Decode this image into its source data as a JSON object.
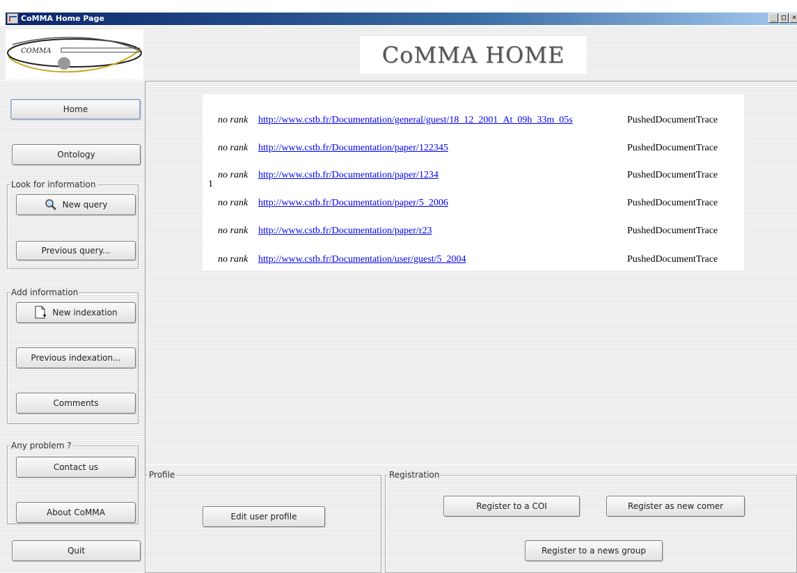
{
  "window": {
    "title": "CoMMA Home Page",
    "controls": [
      "_",
      "□",
      "×"
    ]
  },
  "header": {
    "logo_text": "COMMA",
    "title": "CoMMA HOME"
  },
  "sidebar": {
    "home_label": "Home",
    "ontology_label": "Ontology",
    "look_group": {
      "legend": "Look for information",
      "new_query_label": "New query",
      "previous_query_label": "Previous query..."
    },
    "add_group": {
      "legend": "Add information",
      "new_indexation_label": "New indexation",
      "previous_indexation_label": "Previous indexation...",
      "comments_label": "Comments"
    },
    "problem_group": {
      "legend": "Any problem ?",
      "contact_label": "Contact us",
      "about_label": "About CoMMA"
    },
    "quit_label": "Quit"
  },
  "results": {
    "index": "1",
    "rows": [
      {
        "rank": "no rank",
        "url": "http://www.cstb.fr/Documentation/general/guest/18_12_2001_At_09h_33m_05s",
        "trace": "PushedDocumentTrace"
      },
      {
        "rank": "no rank",
        "url": "http://www.cstb.fr/Documentation/paper/122345",
        "trace": "PushedDocumentTrace"
      },
      {
        "rank": "no rank",
        "url": "http://www.cstb.fr/Documentation/paper/1234",
        "trace": "PushedDocumentTrace"
      },
      {
        "rank": "no rank",
        "url": "http://www.cstb.fr/Documentation/paper/5_2006",
        "trace": "PushedDocumentTrace"
      },
      {
        "rank": "no rank",
        "url": "http://www.cstb.fr/Documentation/paper/r23",
        "trace": "PushedDocumentTrace"
      },
      {
        "rank": "no rank",
        "url": "http://www.cstb.fr/Documentation/user/guest/5_2004",
        "trace": "PushedDocumentTrace"
      }
    ]
  },
  "profile": {
    "legend": "Profile",
    "edit_label": "Edit user profile"
  },
  "registration": {
    "legend": "Registration",
    "coi_label": "Register to a COI",
    "new_comer_label": "Register as new comer",
    "news_group_label": "Register to a news group"
  }
}
